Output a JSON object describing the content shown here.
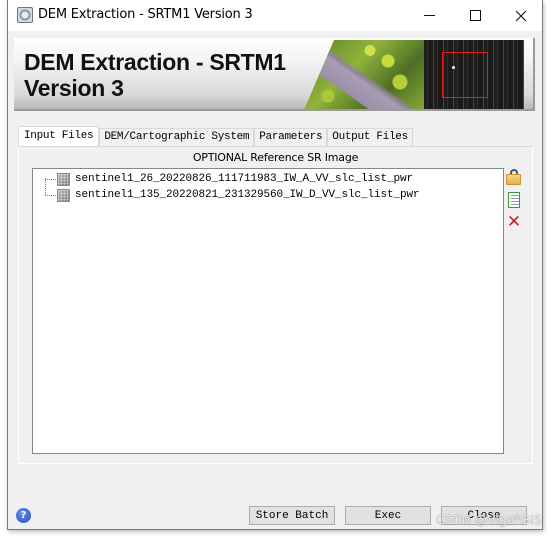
{
  "window": {
    "title": "DEM Extraction - SRTM1 Version 3",
    "controls": {
      "minimize": "minimize",
      "maximize": "maximize",
      "close": "close"
    }
  },
  "banner": {
    "title_line1": "DEM Extraction - SRTM1",
    "title_line2": "Version 3"
  },
  "tabs": [
    {
      "label": "Input Files",
      "active": true
    },
    {
      "label": "DEM/Cartographic System",
      "active": false
    },
    {
      "label": "Parameters",
      "active": false
    },
    {
      "label": "Output Files",
      "active": false
    }
  ],
  "input_files": {
    "section_label": "OPTIONAL Reference SR Image",
    "files": [
      "sentinel1_26_20220826_111711983_IW_A_VV_slc_list_pwr",
      "sentinel1_135_20220821_231329560_IW_D_VV_slc_list_pwr"
    ],
    "side_tools": [
      "open-folder-icon",
      "list-icon",
      "delete-icon"
    ]
  },
  "footer": {
    "help_glyph": "?",
    "buttons": {
      "store_batch": "Store Batch",
      "exec": "Exec",
      "close": "Close"
    }
  },
  "watermark": "CSDN @Vigo*GIS"
}
